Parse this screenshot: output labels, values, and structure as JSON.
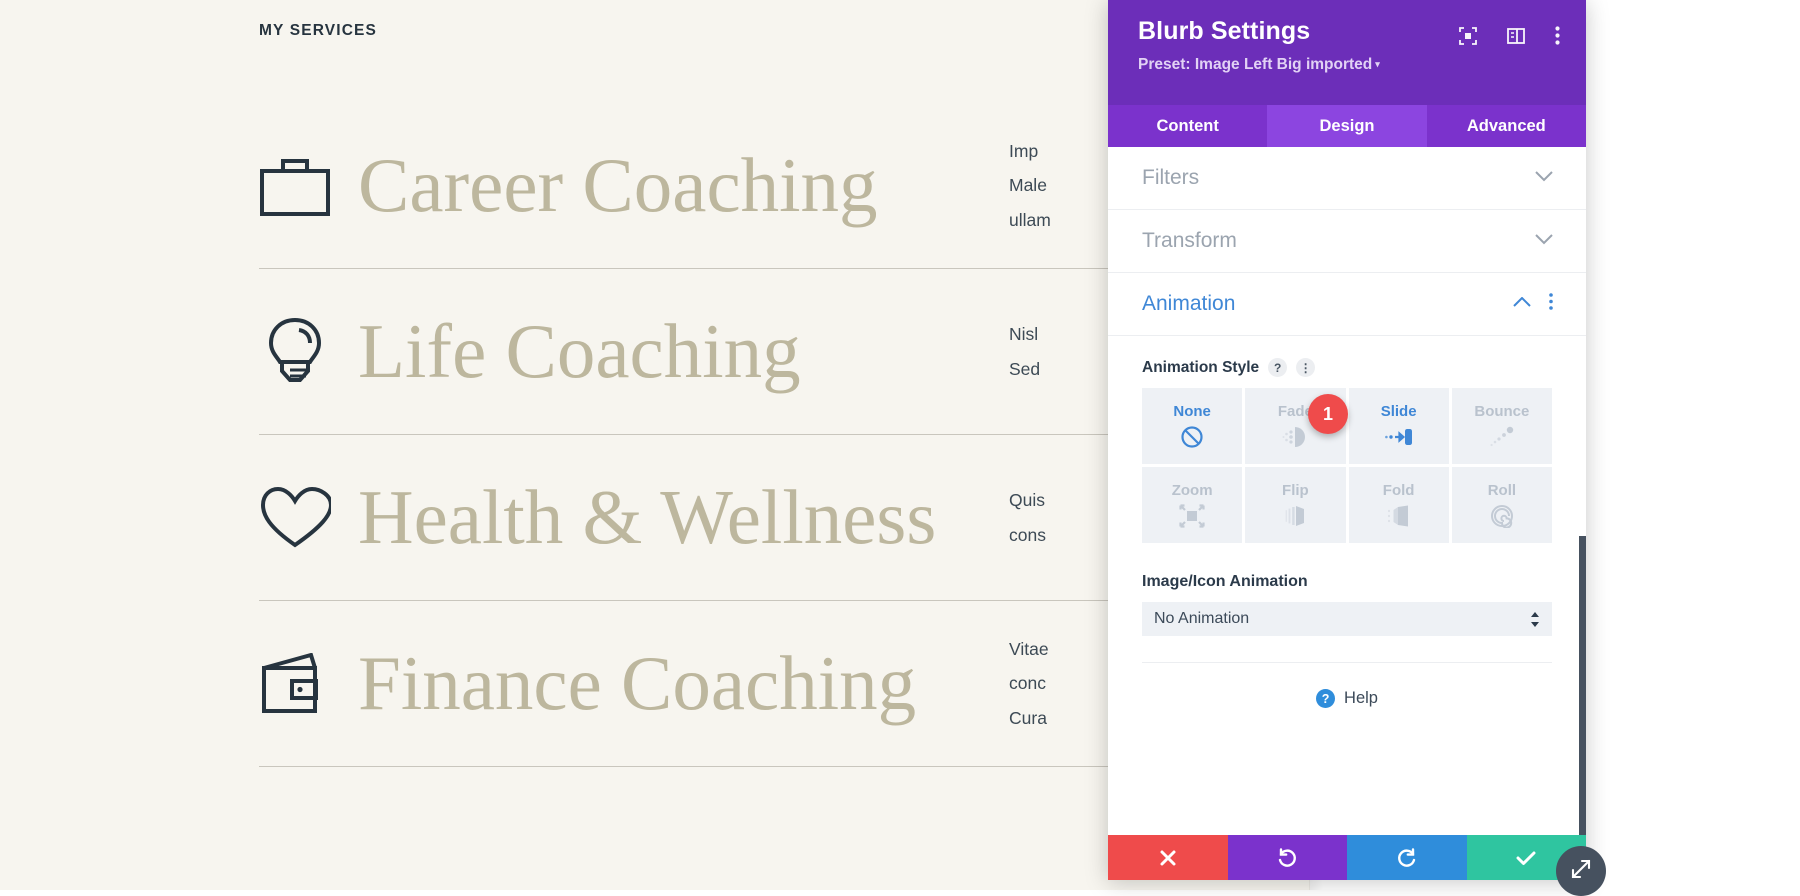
{
  "page": {
    "eyebrow": "MY SERVICES",
    "services": [
      {
        "icon": "briefcase-icon",
        "title": "Career Coaching",
        "body": "Imp\nMale\nullam"
      },
      {
        "icon": "lightbulb-icon",
        "title": "Life Coaching",
        "body": "Nisl\nSed"
      },
      {
        "icon": "heart-icon",
        "title": "Health & Wellness",
        "body": "Quis\ncons"
      },
      {
        "icon": "wallet-icon",
        "title": "Finance Coaching",
        "body": "Vitae\nconc\nCura"
      }
    ]
  },
  "modal": {
    "title": "Blurb Settings",
    "preset_label": "Preset: Image Left Big imported",
    "preset_caret": "▾",
    "header_icons": [
      {
        "name": "target-icon"
      },
      {
        "name": "layout-panel-icon"
      },
      {
        "name": "kebab-menu-icon"
      }
    ],
    "tabs": [
      {
        "label": "Content",
        "active": false
      },
      {
        "label": "Design",
        "active": true
      },
      {
        "label": "Advanced",
        "active": false
      }
    ],
    "sections": [
      {
        "title": "Filters",
        "open": false
      },
      {
        "title": "Transform",
        "open": false
      },
      {
        "title": "Animation",
        "open": true
      }
    ],
    "animation": {
      "field_label": "Animation Style",
      "help_badge": "?",
      "kebab_badge": "⋮",
      "styles": [
        {
          "label": "None",
          "icon": "no-symbol-icon",
          "selected": true
        },
        {
          "label": "Fade",
          "icon": "fade-icon",
          "selected": false
        },
        {
          "label": "Slide",
          "icon": "slide-arrow-icon",
          "selected": true
        },
        {
          "label": "Bounce",
          "icon": "bounce-dots-icon",
          "selected": false
        },
        {
          "label": "Zoom",
          "icon": "zoom-expand-icon",
          "selected": false
        },
        {
          "label": "Flip",
          "icon": "flip-icon",
          "selected": false
        },
        {
          "label": "Fold",
          "icon": "fold-icon",
          "selected": false
        },
        {
          "label": "Roll",
          "icon": "spiral-icon",
          "selected": false
        }
      ],
      "marker_badge": "1",
      "select_label": "Image/Icon Animation",
      "select_value": "No Animation"
    },
    "help": {
      "icon_char": "?",
      "label": "Help"
    },
    "footer_buttons": [
      {
        "name": "cancel-button",
        "icon": "close-x-icon",
        "color": "#ef4b4b"
      },
      {
        "name": "undo-button",
        "icon": "undo-icon",
        "color": "#7b32cc"
      },
      {
        "name": "redo-button",
        "icon": "redo-icon",
        "color": "#2f8ddb"
      },
      {
        "name": "save-button",
        "icon": "checkmark-icon",
        "color": "#2fc5a0"
      }
    ]
  },
  "colors": {
    "brand_purple": "#6c2eb9",
    "tab_purple": "#7b32cc",
    "tab_active": "#8c45e0",
    "accent_blue": "#3f87d6",
    "badge_red": "#ef4b4b",
    "save_green": "#2fc5a0",
    "page_bg": "#f7f5ef",
    "heading_tan": "#bdb79e",
    "icon_navy": "#27343f"
  }
}
